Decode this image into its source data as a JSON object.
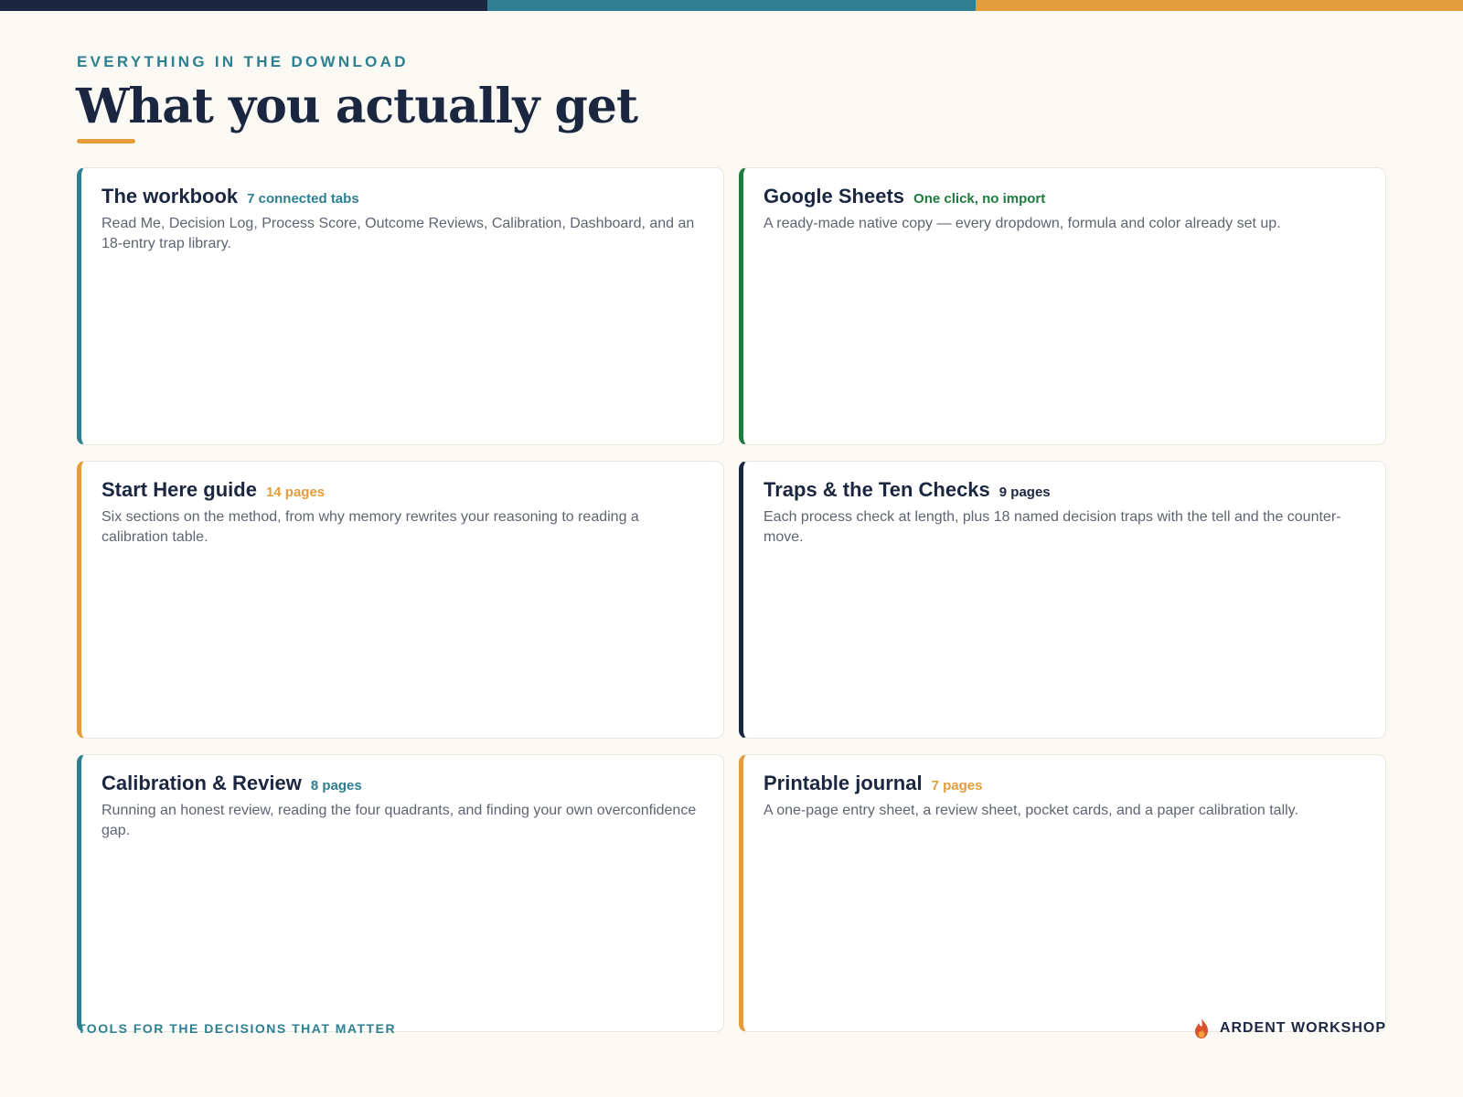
{
  "colors": {
    "navy": "#1b2640",
    "teal": "#2e7f90",
    "orange": "#e59c3c",
    "green": "#1f7a3d",
    "background": "#faf9f4"
  },
  "header": {
    "eyebrow": "EVERYTHING IN THE DOWNLOAD",
    "title": "What you actually get"
  },
  "cards": [
    {
      "title": "The workbook",
      "badge": "7 connected tabs",
      "accent": "#2e7f90",
      "description": "Read Me, Decision Log, Process Score, Outcome Reviews, Calibration, Dashboard, and an 18-entry trap library."
    },
    {
      "title": "Google Sheets",
      "badge": "One click, no import",
      "accent": "#1f7a3d",
      "description": "A ready-made native copy — every dropdown, formula and color already set up."
    },
    {
      "title": "Start Here guide",
      "badge": "14 pages",
      "accent": "#e59c3c",
      "description": "Six sections on the method, from why memory rewrites your reasoning to reading a calibration table."
    },
    {
      "title": "Traps & the Ten Checks",
      "badge": "9 pages",
      "accent": "#1b2640",
      "description": "Each process check at length, plus 18 named decision traps with the tell and the counter-move."
    },
    {
      "title": "Calibration & Review",
      "badge": "8 pages",
      "accent": "#2e7f90",
      "description": "Running an honest review, reading the four quadrants, and finding your own overconfidence gap."
    },
    {
      "title": "Printable journal",
      "badge": "7 pages",
      "accent": "#e59c3c",
      "description": "A one-page entry sheet, a review sheet, pocket cards, and a paper calibration tally."
    }
  ],
  "footer": {
    "tagline": "TOOLS FOR THE DECISIONS THAT MATTER",
    "brand_name": "ARDENT WORKSHOP",
    "brand_icon": "flame-icon"
  }
}
